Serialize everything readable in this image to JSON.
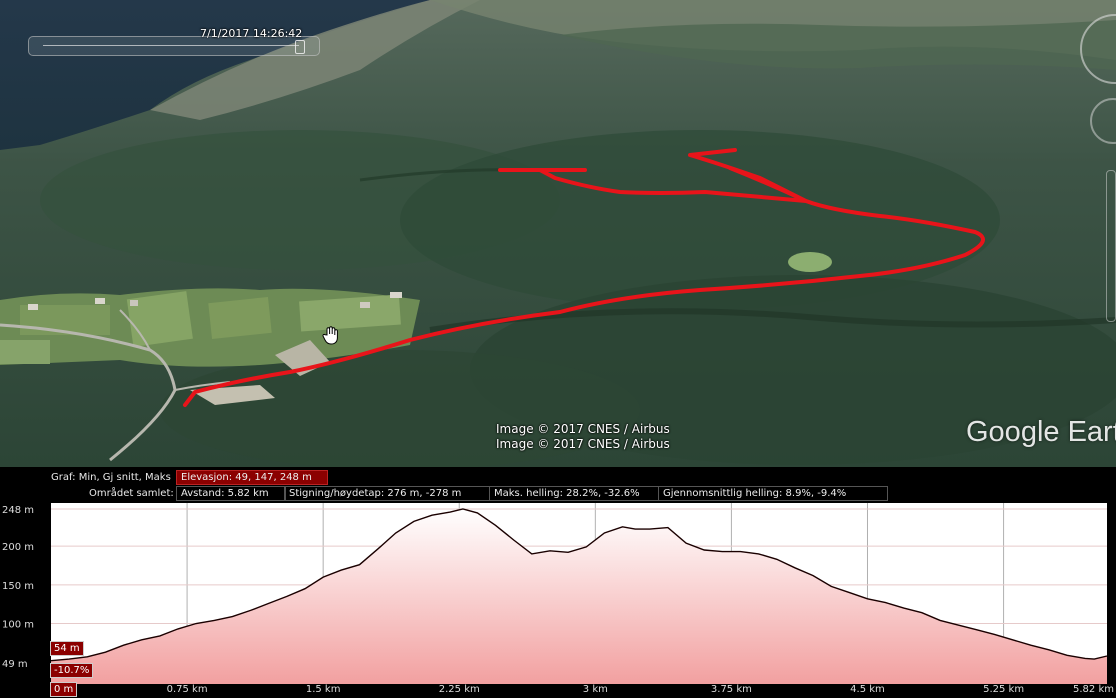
{
  "map": {
    "timestamp": "7/1/2017  14:26:42",
    "imagery_credits": [
      "Image © 2017 CNES / Airbus",
      "Image © 2017 CNES / Airbus"
    ],
    "logo_text": "Google Earth"
  },
  "profile_panel": {
    "graph_label": "Graf: Min, Gj snitt, Maks",
    "elevation": "Elevasjon: 49, 147, 248 m",
    "area_label": "Området samlet:",
    "distance": "Avstand: 5.82 km",
    "climb": "Stigning/høydetap: 276 m, -278 m",
    "max_slope": "Maks. helling: 28.2%, -32.6%",
    "avg_slope": "Gjennomsnittlig helling: 8.9%, -9.4%",
    "cursor_elevation": "54 m",
    "cursor_slope": "-10.7%",
    "cursor_distance": "0 m"
  },
  "chart_data": {
    "type": "area",
    "xlabel": "",
    "ylabel": "",
    "x_ticks": [
      "0.75 km",
      "1.5 km",
      "2.25 km",
      "3 km",
      "3.75 km",
      "4.5 km",
      "5.25 km",
      "5.82 km"
    ],
    "x_tick_values": [
      0.75,
      1.5,
      2.25,
      3.0,
      3.75,
      4.5,
      5.25,
      5.82
    ],
    "y_ticks": [
      "248 m",
      "200 m",
      "150 m",
      "100 m",
      "49 m"
    ],
    "y_tick_values": [
      248,
      200,
      150,
      100,
      49
    ],
    "xlim": [
      0,
      5.82
    ],
    "ylim": [
      49,
      248
    ],
    "grid": true,
    "colors": {
      "fill_top": "#ffffff",
      "fill_bottom": "#f2a0a0",
      "line": "#1a0000",
      "grid": "#b0b0b0"
    },
    "series": [
      {
        "x": [
          0,
          0.1,
          0.2,
          0.3,
          0.4,
          0.5,
          0.6,
          0.7,
          0.8,
          0.9,
          1.0,
          1.1,
          1.2,
          1.3,
          1.4,
          1.5,
          1.6,
          1.7,
          1.8,
          1.9,
          2.0,
          2.1,
          2.2,
          2.27,
          2.35,
          2.45,
          2.55,
          2.65,
          2.75,
          2.85,
          2.95,
          3.05,
          3.15,
          3.22,
          3.3,
          3.4,
          3.5,
          3.6,
          3.7,
          3.8,
          3.9,
          4.0,
          4.1,
          4.2,
          4.3,
          4.4,
          4.5,
          4.6,
          4.7,
          4.8,
          4.9,
          5.0,
          5.1,
          5.2,
          5.3,
          5.4,
          5.5,
          5.6,
          5.7,
          5.75,
          5.82
        ],
        "y": [
          52,
          54,
          57,
          63,
          72,
          79,
          84,
          93,
          100,
          104,
          109,
          117,
          126,
          135,
          145,
          160,
          169,
          176,
          196,
          217,
          232,
          240,
          244,
          248,
          243,
          227,
          208,
          190,
          194,
          192,
          199,
          217,
          225,
          222,
          222,
          224,
          204,
          195,
          193,
          193,
          190,
          183,
          172,
          162,
          148,
          140,
          132,
          127,
          120,
          114,
          104,
          98,
          92,
          86,
          79,
          72,
          66,
          59,
          55,
          54,
          58
        ]
      }
    ]
  }
}
